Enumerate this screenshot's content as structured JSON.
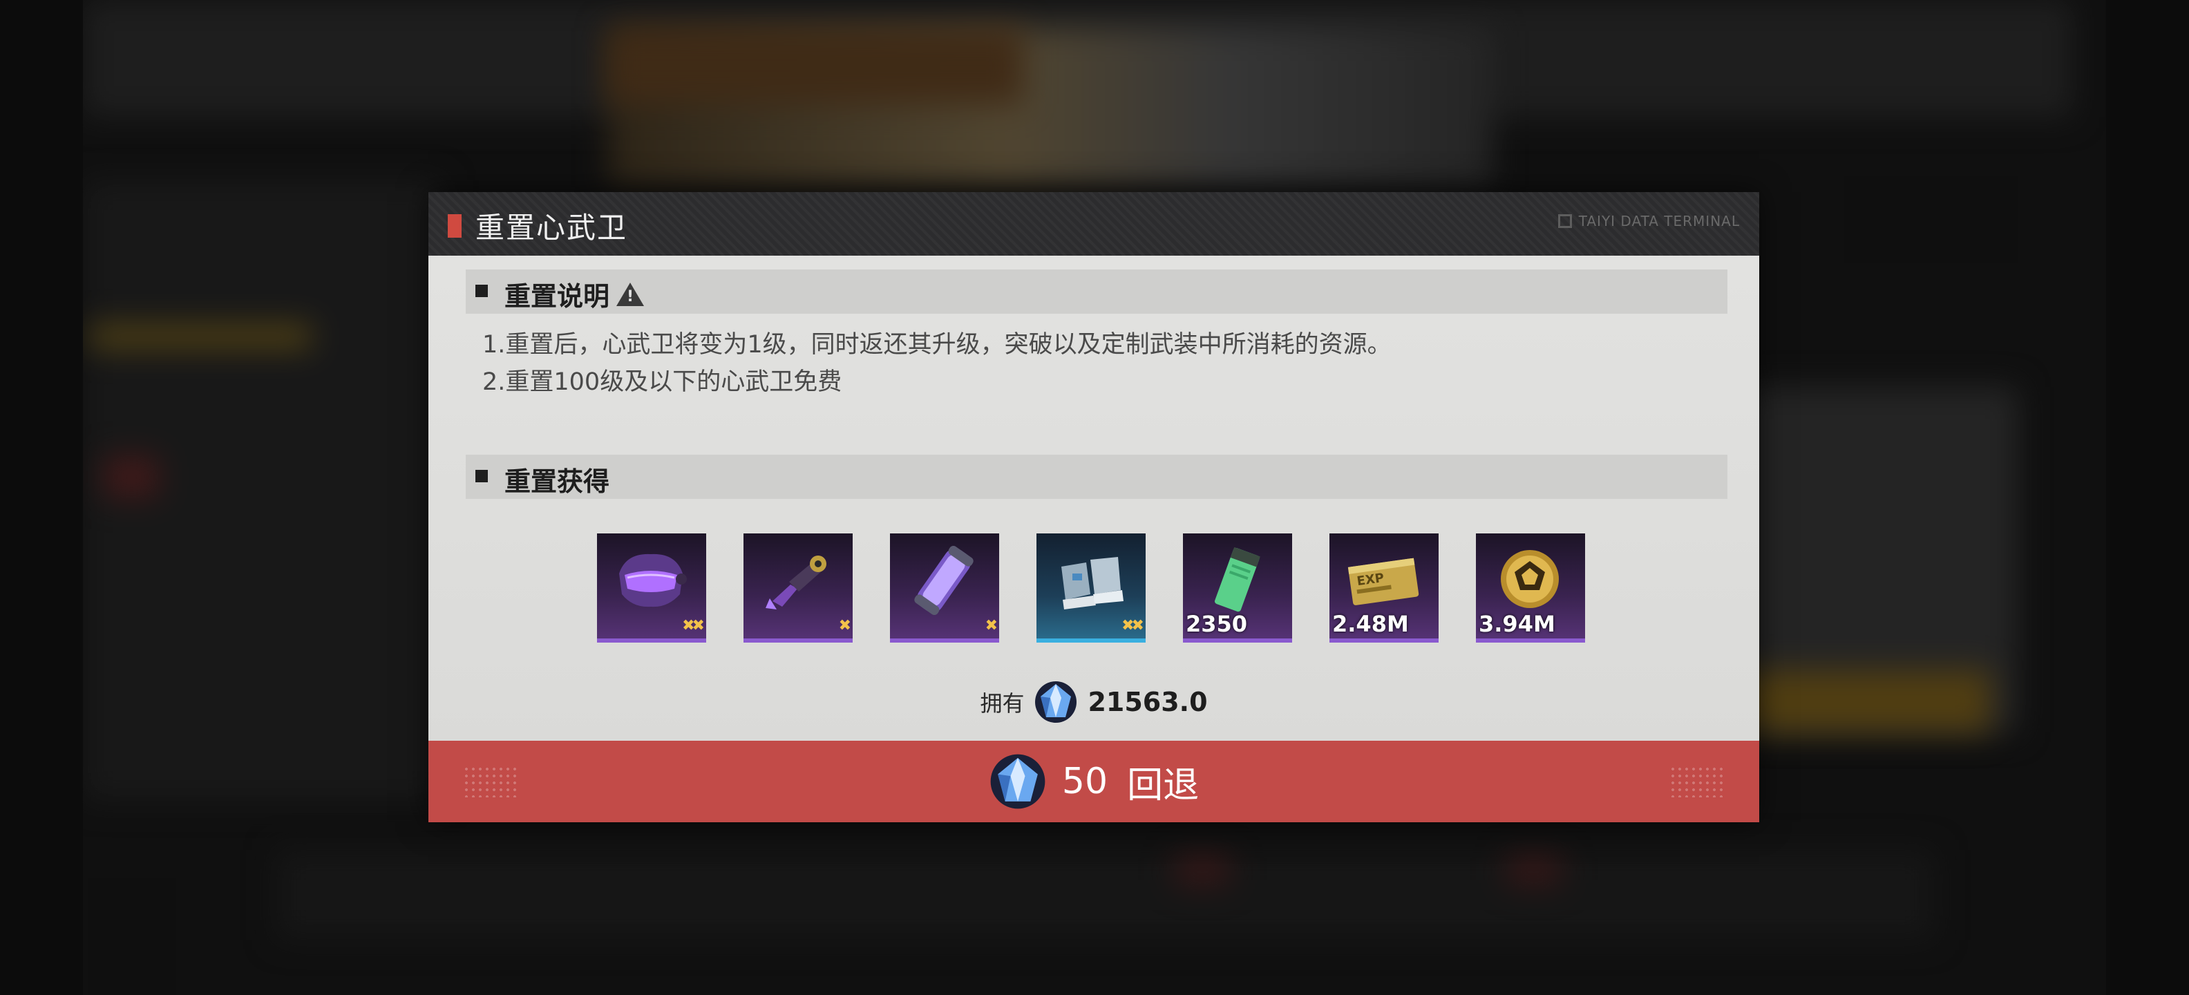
{
  "dialog": {
    "title": "重置心武卫",
    "brand": "TAIYI DATA TERMINAL"
  },
  "instructions": {
    "title": "重置说明",
    "lines": [
      "1.重置后，心武卫将变为1级，同时返还其升级，突破以及定制武装中所消耗的资源。",
      "2.重置100级及以下的心武卫免费"
    ]
  },
  "rewards": {
    "title": "重置获得",
    "items": [
      {
        "icon": "purple-mask-icon",
        "quantity": "",
        "stars": "✖✖",
        "rarity": "purple"
      },
      {
        "icon": "mechanical-arm-icon",
        "quantity": "",
        "stars": "✖",
        "rarity": "purple"
      },
      {
        "icon": "energy-capsule-icon",
        "quantity": "",
        "stars": "✖",
        "rarity": "purple"
      },
      {
        "icon": "armor-boots-icon",
        "quantity": "",
        "stars": "✖✖",
        "rarity": "blue"
      },
      {
        "icon": "green-chip-icon",
        "quantity": "2350",
        "stars": "",
        "rarity": "purple"
      },
      {
        "icon": "exp-card-icon",
        "quantity": "2.48M",
        "stars": "",
        "rarity": "purple"
      },
      {
        "icon": "gold-coin-icon",
        "quantity": "3.94M",
        "stars": "",
        "rarity": "purple"
      }
    ]
  },
  "currency": {
    "owned_label": "拥有",
    "owned_value": "21563.0",
    "icon": "crystal-gem-icon"
  },
  "confirm": {
    "cost": "50",
    "label": "回退"
  },
  "colors": {
    "accent_red": "#c24b48",
    "header_bg": "#2c2c2e",
    "purple_rarity": "#8a5acf",
    "blue_rarity": "#3ab0e0"
  }
}
